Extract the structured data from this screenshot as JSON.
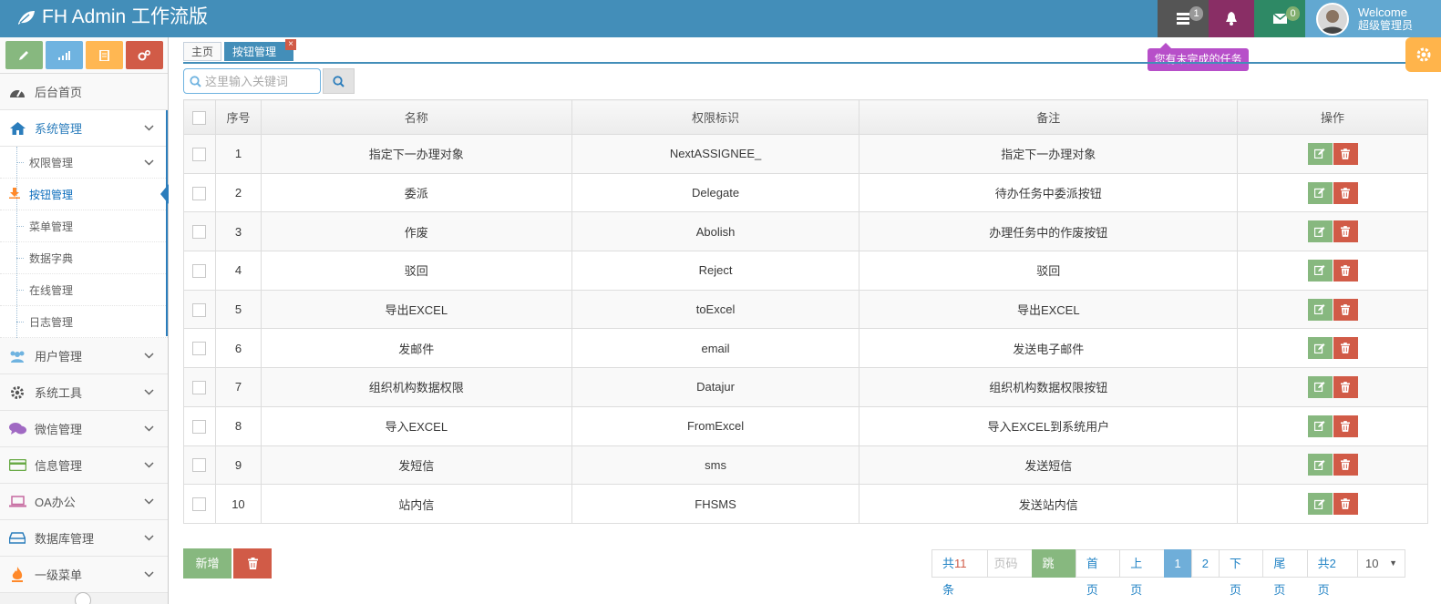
{
  "app": {
    "brand_title": "FH Admin 工作流版"
  },
  "header": {
    "tasks_badge": "1",
    "mail_badge": "0",
    "user_welcome": "Welcome",
    "user_name": "超级管理员",
    "tooltip": "您有未完成的任务"
  },
  "sidebar": {
    "home_label": "后台首页",
    "system_label": "系统管理",
    "sub_items": [
      "权限管理",
      "按钮管理",
      "菜单管理",
      "数据字典",
      "在线管理",
      "日志管理"
    ],
    "groups": [
      "用户管理",
      "系统工具",
      "微信管理",
      "信息管理",
      "OA办公",
      "数据库管理",
      "一级菜单"
    ]
  },
  "tabs": {
    "home": "主页",
    "active": "按钮管理",
    "close": "×"
  },
  "search": {
    "placeholder": "这里输入关键词"
  },
  "table": {
    "headers": [
      "序号",
      "名称",
      "权限标识",
      "备注",
      "操作"
    ],
    "rows": [
      {
        "no": "1",
        "name": "指定下一办理对象",
        "key": "NextASSIGNEE_",
        "note": "指定下一办理对象"
      },
      {
        "no": "2",
        "name": "委派",
        "key": "Delegate",
        "note": "待办任务中委派按钮"
      },
      {
        "no": "3",
        "name": "作废",
        "key": "Abolish",
        "note": "办理任务中的作废按钮"
      },
      {
        "no": "4",
        "name": "驳回",
        "key": "Reject",
        "note": "驳回"
      },
      {
        "no": "5",
        "name": "导出EXCEL",
        "key": "toExcel",
        "note": "导出EXCEL"
      },
      {
        "no": "6",
        "name": "发邮件",
        "key": "email",
        "note": "发送电子邮件"
      },
      {
        "no": "7",
        "name": "组织机构数据权限",
        "key": "Datajur",
        "note": "组织机构数据权限按钮"
      },
      {
        "no": "8",
        "name": "导入EXCEL",
        "key": "FromExcel",
        "note": "导入EXCEL到系统用户"
      },
      {
        "no": "9",
        "name": "发短信",
        "key": "sms",
        "note": "发送短信"
      },
      {
        "no": "10",
        "name": "站内信",
        "key": "FHSMS",
        "note": "发送站内信"
      }
    ]
  },
  "footer": {
    "add_label": "新增",
    "pager": {
      "total_prefix": "共",
      "total_count": "11",
      "total_suffix": "条",
      "page_input_placeholder": "页码",
      "jump": "跳转",
      "first": "首页",
      "prev": "上页",
      "pages": [
        "1",
        "2"
      ],
      "current": "1",
      "next": "下页",
      "last": "尾页",
      "total_pages": "共2页",
      "page_size": "10"
    }
  },
  "colors": {
    "navbar": "#438eb9",
    "green": "#87b87f",
    "red": "#d15b47",
    "orange": "#ffb752",
    "purple_tooltip": "#b74fc9"
  }
}
